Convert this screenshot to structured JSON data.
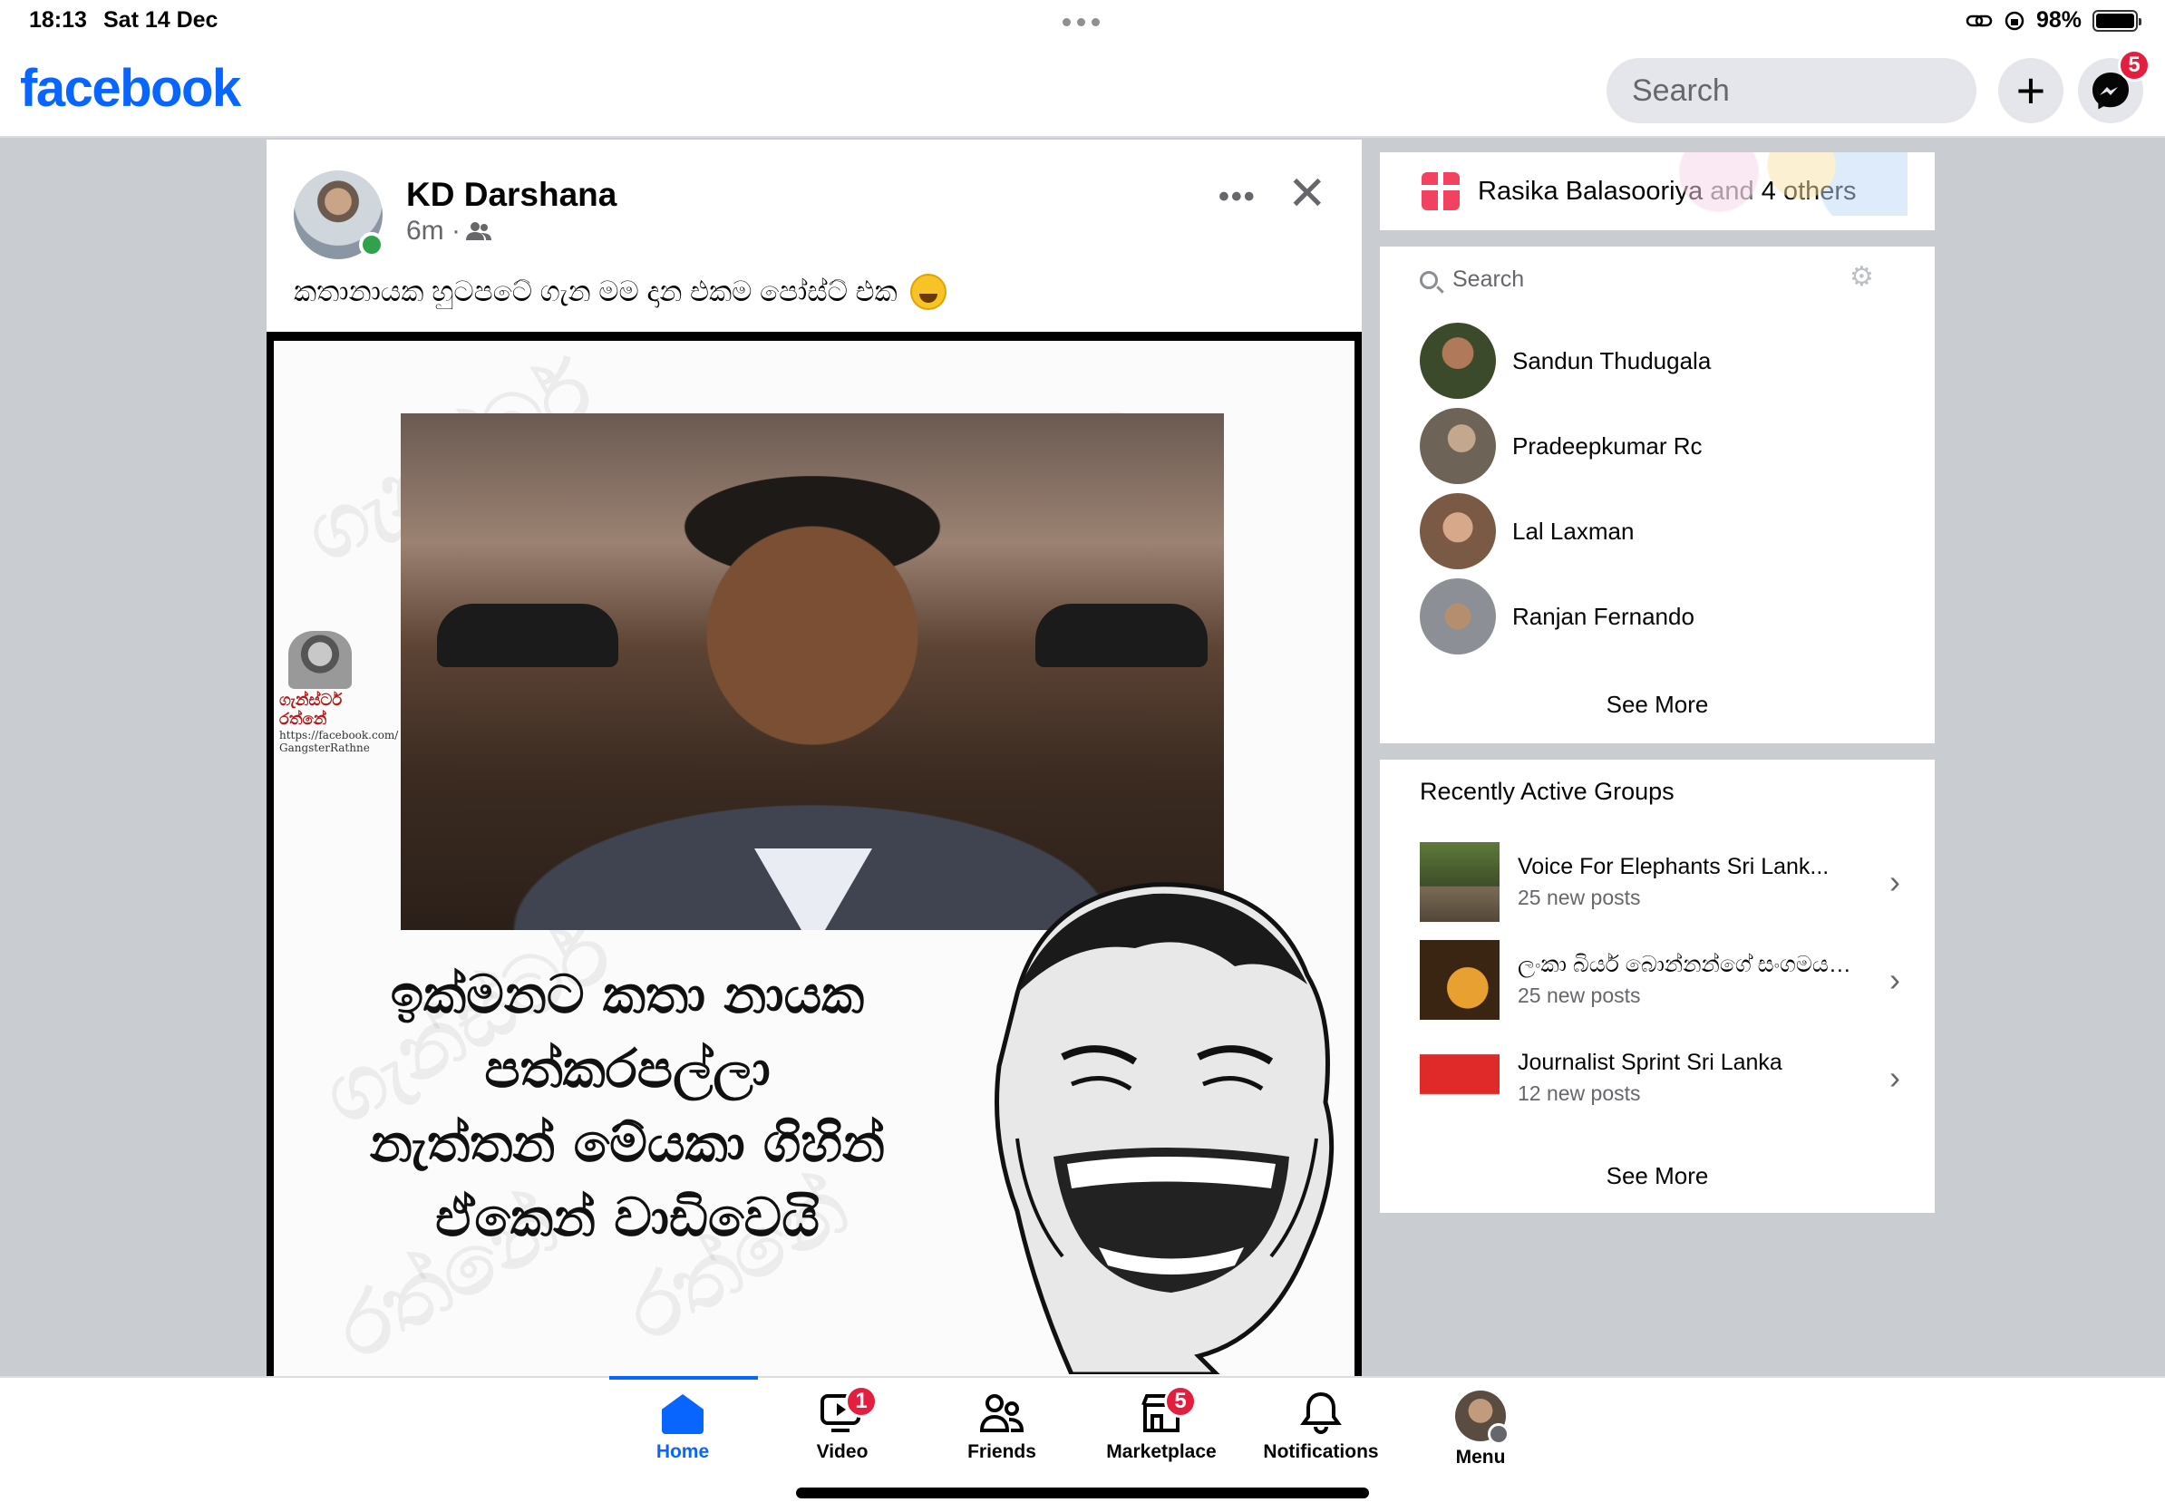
{
  "status_bar": {
    "time": "18:13",
    "date": "Sat 14 Dec",
    "battery": "98%"
  },
  "header": {
    "logo": "facebook",
    "search_placeholder": "Search",
    "messenger_badge": "5"
  },
  "post": {
    "author": "KD Darshana",
    "time": "6m ·",
    "text": "කතානායක හුටපටේ ගැන මම දාන එකම පෝස්ට් එක",
    "meme_caption": [
      "ඉක්මනට කතා නායක",
      "පත්කරපල්ලා",
      "නැත්තන් මේයකා ගිහින්",
      "ඒකෙන් වාඩිවෙයි"
    ],
    "meme_logo_name": "ගැන්ස්ටර් රත්නේ",
    "meme_logo_url": "https://facebook.com/ GangsterRathne"
  },
  "birthday": {
    "name": "Rasika Balasooriya",
    "and": "and",
    "others": "4 others"
  },
  "contacts": {
    "search_placeholder": "Search",
    "items": [
      {
        "name": "Sandun Thudugala",
        "color": "#3c4a2c"
      },
      {
        "name": "Pradeepkumar Rc",
        "color": "#6d6356"
      },
      {
        "name": "Lal Laxman",
        "color": "#7b5a45"
      },
      {
        "name": "Ranjan Fernando",
        "color": "#8c8f95"
      }
    ],
    "see_more": "See More"
  },
  "groups": {
    "title": "Recently Active Groups",
    "items": [
      {
        "name": "Voice For Elephants Sri Lank...",
        "sub": "25 new posts"
      },
      {
        "name": "ලංකා බියර් බොන්නන්ගේ සංගමය -...",
        "sub": "25 new posts"
      },
      {
        "name": "Journalist Sprint Sri Lanka",
        "sub": "12 new posts"
      }
    ],
    "see_more": "See More"
  },
  "tabs": [
    {
      "label": "Home",
      "badge": ""
    },
    {
      "label": "Video",
      "badge": "1"
    },
    {
      "label": "Friends",
      "badge": ""
    },
    {
      "label": "Marketplace",
      "badge": "5"
    },
    {
      "label": "Notifications",
      "badge": ""
    },
    {
      "label": "Menu",
      "badge": ""
    }
  ],
  "colors": {
    "brand": "#0866ff",
    "badge": "#e41e3f",
    "online": "#31a24c"
  }
}
